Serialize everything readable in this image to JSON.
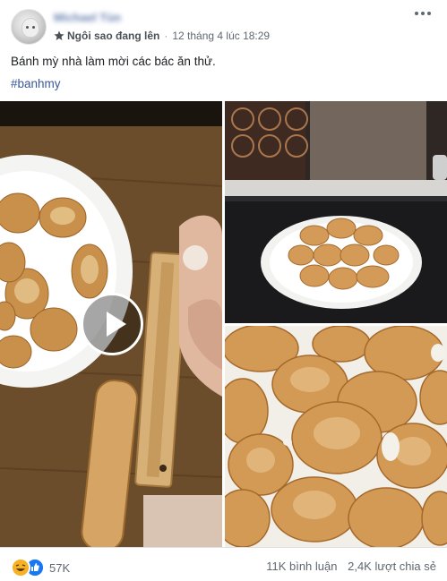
{
  "post": {
    "author_name": "Michael Tùn",
    "badge_label": "Ngôi sao đang lên",
    "timestamp": "12 tháng 4 lúc 18:29",
    "caption": "Bánh mỳ nhà làm mời các bác ăn thử.",
    "hashtag": "#banhmy"
  },
  "footer": {
    "reaction_count": "57K",
    "comments": "11K bình luận",
    "shares": "2,4K lượt chia sẻ"
  },
  "icons": [
    "star-icon",
    "more-options-icon",
    "play-icon",
    "haha-reaction-icon",
    "like-reaction-icon"
  ],
  "colors": {
    "link_blue": "#385898",
    "meta_gray": "#616770",
    "like_blue": "#1877f2",
    "haha_yellow": "#f7b125"
  }
}
